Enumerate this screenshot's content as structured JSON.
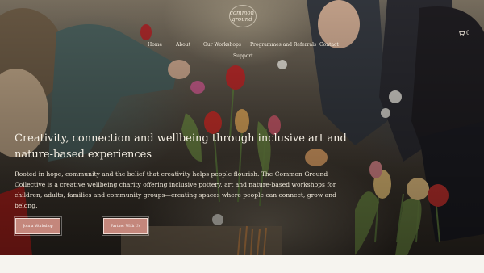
{
  "logo": {
    "line1": "common",
    "line2": "ground"
  },
  "nav": {
    "items": [
      "Home",
      "About",
      "Our Workshops",
      "Programmes and Referrals",
      "Contact",
      "Support"
    ]
  },
  "cart": {
    "count": "0",
    "icon": "cart-icon"
  },
  "hero": {
    "headline": "Creativity, connection and wellbeing through inclusive art and nature-based experiences",
    "body": "Rooted in hope, community and the belief that creativity helps people flourish. The Common Ground Collective is a creative wellbeing charity offering inclusive pottery, art and nature-based workshops for children, adults, families and community groups—creating spaces where people can connect, grow and belong.",
    "button_primary": "Join a Workshop",
    "button_secondary": "Partner With Us"
  },
  "colors": {
    "button_fill": "#c4877c",
    "text_light": "#f3ecdf",
    "footer_band": "#f6f4ef"
  }
}
